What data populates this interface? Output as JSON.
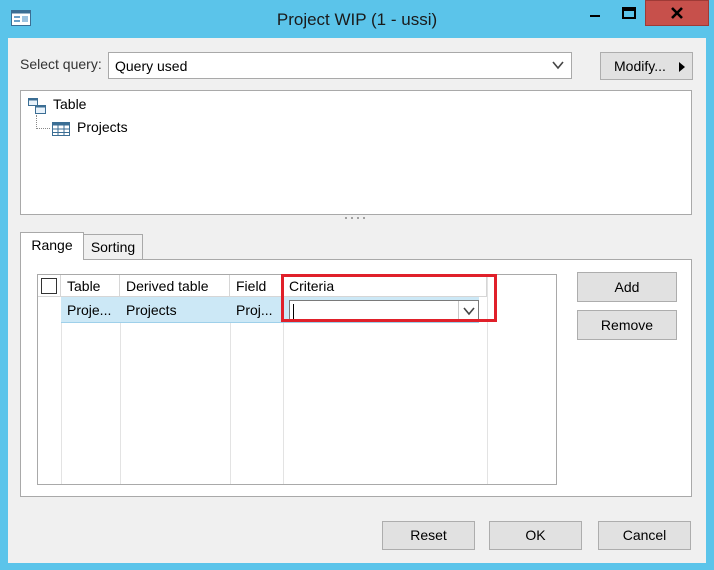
{
  "window": {
    "title": "Project WIP (1 - ussi)",
    "controls": [
      "minimize-icon",
      "maximize-icon",
      "close-icon"
    ]
  },
  "query": {
    "label": "Select query:",
    "value": "Query used",
    "modify_label": "Modify..."
  },
  "tree": {
    "root": {
      "label": "Table",
      "icon": "table-hierarchy-icon"
    },
    "children": [
      {
        "label": "Projects",
        "icon": "grid-table-icon"
      }
    ]
  },
  "tabs": [
    {
      "label": "Range",
      "active": true
    },
    {
      "label": "Sorting",
      "active": false
    }
  ],
  "grid": {
    "columns": [
      "Table",
      "Derived table",
      "Field",
      "Criteria"
    ],
    "rows": [
      {
        "table": "Proje...",
        "derived_table": "Projects",
        "field": "Proj...",
        "criteria": ""
      }
    ]
  },
  "side_buttons": {
    "add": "Add",
    "remove": "Remove"
  },
  "footer": {
    "reset": "Reset",
    "ok": "OK",
    "cancel": "Cancel"
  },
  "colors": {
    "titlebar": "#5bc4ea",
    "close_button": "#c7504b",
    "selected_row": "#cce8f6",
    "highlight_box": "#e0202a"
  }
}
